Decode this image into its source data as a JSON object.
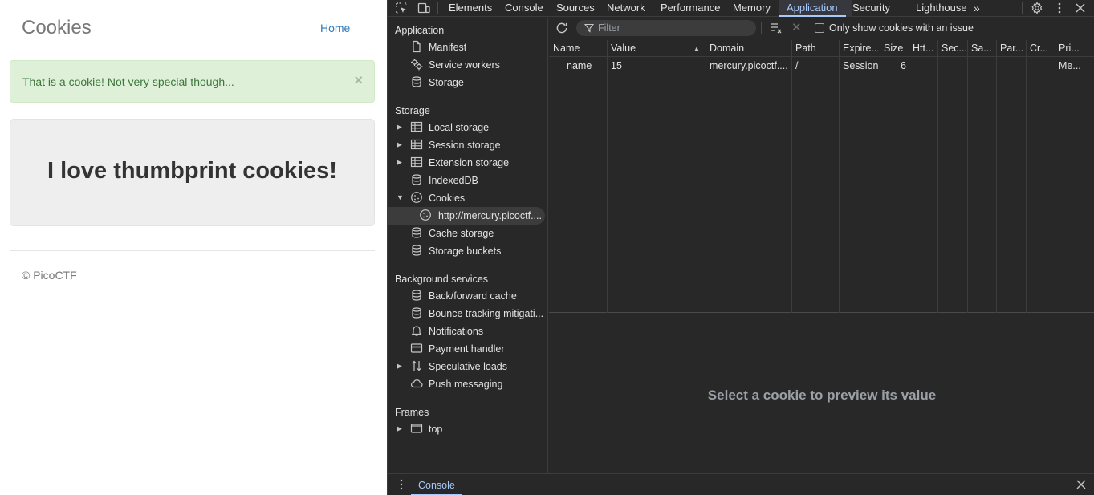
{
  "page": {
    "site_title": "Cookies",
    "home_link": "Home",
    "alert_text": "That is a cookie! Not very special though...",
    "alert_close": "×",
    "jumbotron_text": "I love thumbprint cookies!",
    "footer": "© PicoCTF"
  },
  "devtools": {
    "tabs": [
      "Elements",
      "Console",
      "Sources",
      "Network",
      "Performance",
      "Memory",
      "Application",
      "Security",
      "Lighthouse"
    ],
    "active_tab": "Application",
    "more_tabs": "»",
    "sidebar": {
      "application_header": "Application",
      "application_items": [
        "Manifest",
        "Service workers",
        "Storage"
      ],
      "storage_header": "Storage",
      "storage_items": [
        "Local storage",
        "Session storage",
        "Extension storage",
        "IndexedDB",
        "Cookies",
        "http://mercury.picoctf....",
        "Cache storage",
        "Storage buckets"
      ],
      "background_header": "Background services",
      "background_items": [
        "Back/forward cache",
        "Bounce tracking mitigati...",
        "Notifications",
        "Payment handler",
        "Speculative loads",
        "Push messaging"
      ],
      "frames_header": "Frames",
      "frames_items": [
        "top"
      ]
    },
    "cookies": {
      "filter_placeholder": "Filter",
      "only_issue_label": "Only show cookies with an issue",
      "columns": [
        "Name",
        "Value",
        "Domain",
        "Path",
        "Expire...",
        "Size",
        "Htt...",
        "Sec...",
        "Sa...",
        "Par...",
        "Cr...",
        "Pri..."
      ],
      "rows": [
        [
          "name",
          "15",
          "mercury.picoctf....",
          "/",
          "Session",
          "6",
          "",
          "",
          "",
          "",
          "",
          "Me..."
        ]
      ],
      "preview_text": "Select a cookie to preview its value"
    },
    "drawer": {
      "tab": "Console"
    }
  }
}
